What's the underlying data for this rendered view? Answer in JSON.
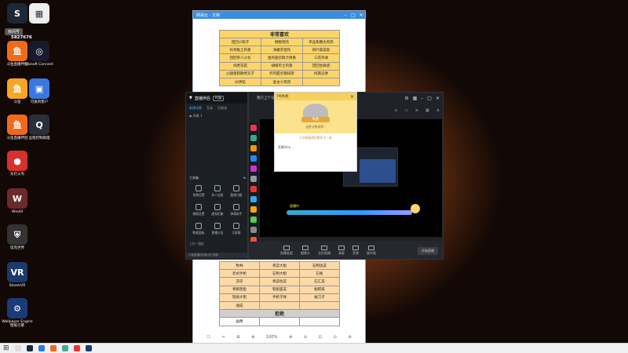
{
  "desktop": {
    "room_label": "房间号",
    "room_number": "5827676",
    "icons": [
      {
        "label": "斗鱼直播伴侣",
        "color": "#ef6b1b",
        "glyph": "鱼"
      },
      {
        "label": "Ubisoft Connect",
        "color": "#1a1a2e",
        "glyph": "◎"
      },
      {
        "label": "斗鱼",
        "color": "#f5a623",
        "glyph": "鱼"
      },
      {
        "label": "可爱的客户",
        "color": "#3a78e0",
        "glyph": "▣"
      },
      {
        "label": "斗鱼直播伴侣",
        "color": "#ef6b1b",
        "glyph": "鱼"
      },
      {
        "label": "远程控制助理",
        "color": "#2a2f3a",
        "glyph": "Q"
      },
      {
        "label": "东打火鸟",
        "color": "#d4312f",
        "glyph": "●"
      },
      {
        "label": "WinAll",
        "color": "#6a2a2a",
        "glyph": "W"
      },
      {
        "label": "坦克世界",
        "color": "#333",
        "glyph": "⛨"
      },
      {
        "label": "SteamVR",
        "color": "#1b3a6b",
        "glyph": "VR"
      },
      {
        "label": "Wallpaper Engine 壁纸引擎",
        "color": "#1a3b78",
        "glyph": "⚙"
      }
    ],
    "top_icons": [
      {
        "label": "",
        "color": "#1b2838",
        "glyph": "S"
      },
      {
        "label": "",
        "color": "#eee",
        "glyph": "▦"
      }
    ]
  },
  "document": {
    "title": "网易云 - 文档",
    "table_title": "非常喜欢",
    "top_rows": [
      [
        "回回小粽子",
        "棍棍馄饨",
        "单品焦糖太肉卷"
      ],
      [
        "托举脆土鸡香",
        "海螺壳馄饨",
        "四叶蔬菜饭"
      ],
      [
        "回回单人沙龙",
        "金鸡翅云鲜汁牌香",
        "三花鸡球"
      ],
      [
        "炖煮花菇",
        "胡椒鸡土鸡香",
        "回回生鲜烧"
      ],
      [
        "火腿蛋糕散烤叉子",
        "炸鸡甜点猪排卷",
        "炖南瓜饼"
      ],
      [
        "炒饼馅",
        "复古小宾鸽",
        ""
      ]
    ],
    "bottom_rows": [
      [
        "牧林",
        "青菜大姐",
        "石制饭菜"
      ],
      [
        "老式手枪",
        "石制大姐",
        "石板"
      ],
      [
        "凉凉",
        "青菜粒菜",
        "石汇菜"
      ],
      [
        "青鲜刮鱼",
        "铁屋面菜",
        "黏糕排"
      ],
      [
        "铁质大刨",
        "手枪子弹",
        "破刀子"
      ],
      [
        "速成",
        "",
        ""
      ]
    ],
    "section_refuse": "拒绝",
    "last_row": [
      "画像",
      "",
      ""
    ],
    "bottom_bar": [
      "☐",
      "✂",
      "⊞",
      "⊕",
      "100%",
      "⊕",
      "⊖",
      "⊡",
      "⊙",
      "⊘"
    ]
  },
  "helper": {
    "app_name": "直播伴侣",
    "badge": "PC版",
    "tabs": [
      "新建场景",
      "互动",
      "可选场"
    ],
    "scene": "场景 1",
    "tools_label": "工具箱",
    "tools": [
      "场景设置",
      "多人连麦",
      "整理功能",
      "美颜设置",
      "虚拟形象",
      "弹幕助手",
      "数据面板",
      "直播公告",
      "大屏幕"
    ],
    "footer": "三分一选区",
    "notice": "斗鱼直播伴侣版本已更新"
  },
  "stream": {
    "title": "我只上个马的打工",
    "controls": [
      "帧数",
      "画面",
      "-",
      "□",
      "✕"
    ],
    "bottom_buttons": [
      "直播画面",
      "摄像头",
      "全民直播",
      "录屏",
      "音频",
      "画中画"
    ],
    "start_button": "开始直播",
    "live_bar_text": "直播中",
    "apps": [
      "#e35",
      "#3a8",
      "#e90",
      "#28e",
      "#c3c",
      "#999",
      "#e33",
      "#3ae",
      "#fa0",
      "#5c5",
      "#888",
      "#e53",
      "#3cf"
    ]
  },
  "popup": {
    "title": "PK失败",
    "close": "×",
    "fail_text": "失败",
    "note": "连胜次数清零 !",
    "sub": "下次再接再厉胜任下一轮",
    "small": "直播间PK"
  },
  "taskbar": {
    "items": [
      {
        "color": "#ddd"
      },
      {
        "color": "#1b2838"
      },
      {
        "color": "#2b7de9"
      },
      {
        "color": "#ef6b1b"
      },
      {
        "color": "#4a9"
      },
      {
        "color": "#e33"
      },
      {
        "color": "#1a3b78"
      }
    ]
  }
}
